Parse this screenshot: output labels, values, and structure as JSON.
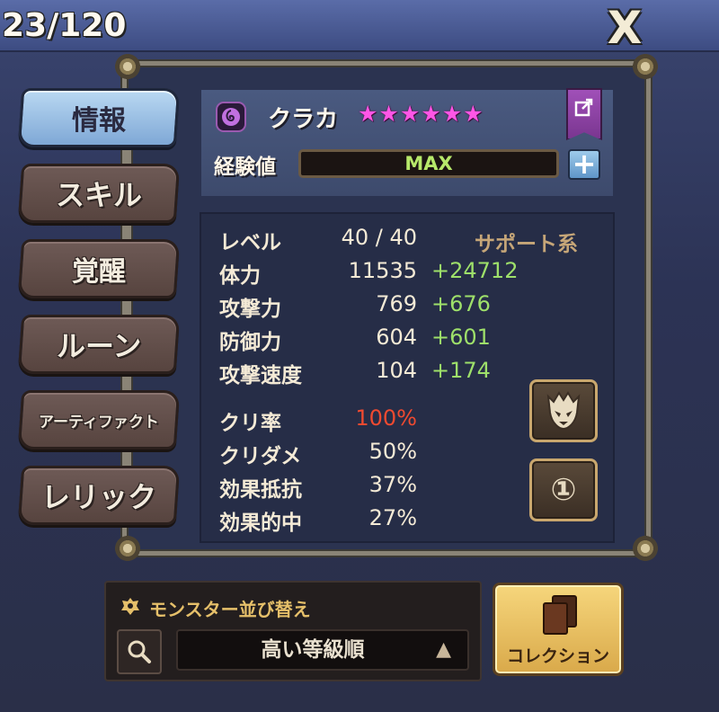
{
  "header": {
    "counter": "23/120",
    "close_label": "X"
  },
  "tabs": [
    {
      "label": "情報",
      "active": true
    },
    {
      "label": "スキル",
      "active": false
    },
    {
      "label": "覚醒",
      "active": false
    },
    {
      "label": "ルーン",
      "active": false
    },
    {
      "label": "アーティファクト",
      "active": false
    },
    {
      "label": "レリック",
      "active": false
    }
  ],
  "monster": {
    "element_icon": "dark-element-icon",
    "name": "クラカ",
    "stars": [
      "★",
      "★",
      "★",
      "★",
      "★",
      "★"
    ],
    "exp_label": "経験値",
    "exp_value": "MAX",
    "exp_plus": "+"
  },
  "stats": {
    "level_label": "レベル",
    "level_value": "40 / 40",
    "type": "サポート系",
    "rows": [
      {
        "label": "体力",
        "value": "11535",
        "bonus": "+24712"
      },
      {
        "label": "攻撃力",
        "value": "769",
        "bonus": "+676"
      },
      {
        "label": "防御力",
        "value": "604",
        "bonus": "+601"
      },
      {
        "label": "攻撃速度",
        "value": "104",
        "bonus": "+174"
      }
    ],
    "secondary": [
      {
        "label": "クリ率",
        "value": "100%",
        "color": "#f04a30"
      },
      {
        "label": "クリダメ",
        "value": "50%"
      },
      {
        "label": "効果抵抗",
        "value": "37%"
      },
      {
        "label": "効果的中",
        "value": "27%"
      }
    ]
  },
  "side_buttons": {
    "mask_icon": "mask-icon",
    "slot_number": "①"
  },
  "sort": {
    "title": "モンスター並び替え",
    "selected": "高い等級順",
    "arrow": "▲"
  },
  "collection": {
    "label": "コレクション"
  },
  "colors": {
    "star": "#ff56e6",
    "bonus": "#9ee06a",
    "crit": "#f04a30",
    "type": "#c6a678",
    "active_tab": "#9cc2e6"
  }
}
